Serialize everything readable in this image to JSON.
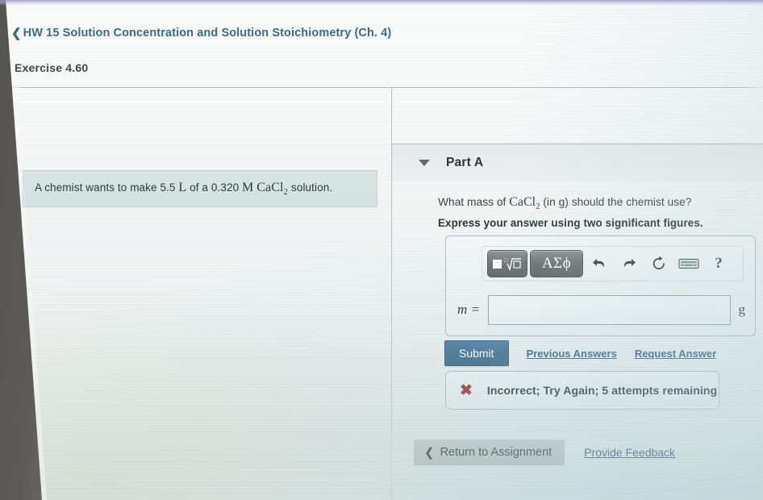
{
  "header": {
    "back_icon": "chevron-left-icon",
    "breadcrumb": "HW 15 Solution Concentration and Solution Stoichiometry (Ch. 4)",
    "exercise": "Exercise 4.60"
  },
  "problem": {
    "text_before": "A chemist wants to make 5.5",
    "unit_volume": "L",
    "text_mid": "of a 0.320",
    "unit_molarity": "M",
    "formula": "CaCl",
    "formula_sub": "2",
    "text_after": "solution."
  },
  "part": {
    "caret_icon": "caret-down-icon",
    "title": "Part A",
    "question_before": "What mass of",
    "question_formula": "CaCl",
    "question_formula_sub": "2",
    "question_after": "(in g) should the chemist use?",
    "instruction": "Express your answer using two significant figures."
  },
  "toolbar": {
    "template_button": {
      "name": "math-template-button",
      "square_glyph": "■",
      "root_glyph": "√"
    },
    "greek_button_label": "ΑΣϕ",
    "undo_icon": "undo-arrow-icon",
    "redo_icon": "redo-arrow-icon",
    "reset_icon": "reset-circular-arrow-icon",
    "keyboard_icon": "keyboard-icon",
    "help_label": "?"
  },
  "answer": {
    "label": "m =",
    "value": "",
    "placeholder": "",
    "unit": "g"
  },
  "actions": {
    "submit_label": "Submit",
    "previous_answers_label": "Previous Answers",
    "request_answer_label": "Request Answer"
  },
  "feedback": {
    "status_icon": "x-mark-icon",
    "message": "Incorrect; Try Again; 5 attempts remaining",
    "color": "#9e2b2b"
  },
  "bottom": {
    "back_icon": "chevron-left-icon",
    "return_label": "Return to Assignment",
    "provide_feedback_label": "Provide Feedback"
  },
  "colors": {
    "breadcrumb": "#3d6b80",
    "submit": "#3f6c90",
    "link": "#2f5f7d",
    "problem_panel": "#d8e5e2"
  }
}
